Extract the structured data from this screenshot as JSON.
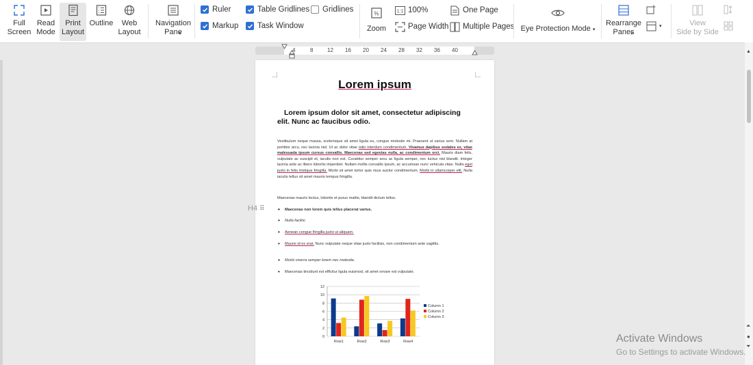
{
  "ribbon": {
    "full_screen": "Full\nScreen",
    "read_mode": "Read\nMode",
    "print_layout": "Print\nLayout",
    "outline": "Outline",
    "web_layout": "Web\nLayout",
    "navigation_pane": "Navigation\nPane",
    "ruler": "Ruler",
    "markup": "Markup",
    "table_gridlines": "Table Gridlines",
    "task_window": "Task Window",
    "gridlines": "Gridlines",
    "zoom": "Zoom",
    "zoom_100": "100%",
    "page_width": "Page Width",
    "one_page": "One Page",
    "multiple_pages": "Multiple Pages",
    "eye_protection": "Eye Protection Mode",
    "rearrange_panes": "Rearrange\nPanes",
    "view_side_by_side": "View\nSide by Side"
  },
  "ruler": {
    "ticks": [
      "4",
      "8",
      "12",
      "16",
      "20",
      "24",
      "28",
      "32",
      "36",
      "40"
    ]
  },
  "document": {
    "title": "Lorem ipsum",
    "subtitle": "Lorem ipsum dolor sit amet, consectetur adipiscing elit. Nunc ac faucibus odio.",
    "para1_a": "Vestibulum neque massa, scelerisque sit amet ligula eu, congue molestie mi. Praesent ut varius sem. Nullam at porttitor arcu, nec lacinia nisl. Ut ac dolor vitae ",
    "para1_u1": "odio interdum condimentum.",
    "para1_b": " Vivamus dapibus sodales ex, vitae malesuada ipsum cursus convallis. Maecenas sed egestas nulla, ac condimentum orci.",
    "para1_c": " Mauris diam felis, vulputate ac suscipit et, iaculis non est. Curabitur semper arcu ac ligula semper, nec luctus nisl blandit. Integer lacinia ante ac libero lobortis imperdiet. Nullam mollis convallis ipsum, ac accumsan nunc vehicula vitae. Nulla ",
    "para1_u2": "eget justo in felis tristique fringilla.",
    "para1_d": " Morbi sit amet tortor quis risus auctor condimentum. ",
    "para1_u3": "Morbi in ullamcorper elit.",
    "para1_e": " Nulla iaculis tellus sit amet mauris tempus fringilla.",
    "para2": "Maecenas mauris lectus, lobortis et purus mattis, blandit dictum tellus.",
    "bullets": [
      "Maecenas non lorem quis tellus placerat varius.",
      "Nulla facilisi.",
      "Aenean congue fringilla justo ut aliquam.",
      "Mauris id ex erat.",
      "Morbi viverra semper lorem nec molestie.",
      "Maecenas tincidunt est efficitur ligula euismod, sit amet ornare est vulputate."
    ],
    "bullet4_rest": " Nunc vulputate neque vitae justo facilisis, non condimentum ante sagittis."
  },
  "h4_label": "H4",
  "activate": {
    "line1": "Activate Windows",
    "line2": "Go to Settings to activate Windows."
  },
  "colors": {
    "accent": "#2f6fd1",
    "col1": "#0d3a8c",
    "col2": "#e0261b",
    "col3": "#f7c81e"
  },
  "chart_data": {
    "type": "bar",
    "categories": [
      "Row1",
      "Row2",
      "Row3",
      "Row4"
    ],
    "series": [
      {
        "name": "Column 1",
        "values": [
          9.1,
          2.4,
          3.1,
          4.3
        ]
      },
      {
        "name": "Column 2",
        "values": [
          3.2,
          8.8,
          1.5,
          9.0
        ]
      },
      {
        "name": "Column 3",
        "values": [
          4.5,
          9.7,
          3.7,
          6.2
        ]
      }
    ],
    "ylim": [
      0,
      12
    ],
    "yticks": [
      "0",
      "2",
      "4",
      "6",
      "8",
      "10",
      "12"
    ],
    "legend": "right",
    "grid": true
  }
}
